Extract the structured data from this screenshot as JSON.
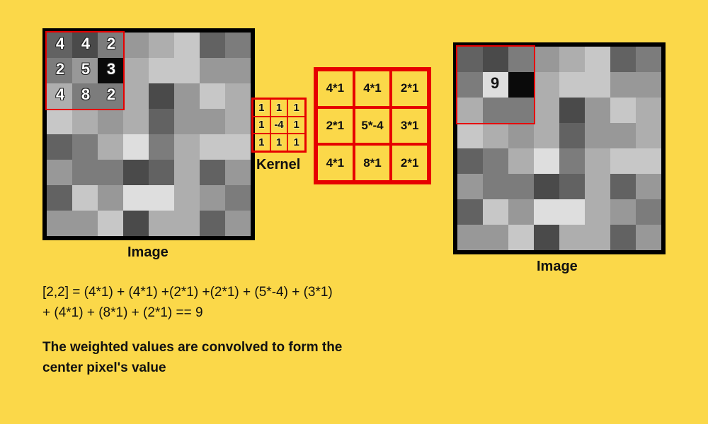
{
  "colors": {
    "shades": [
      "#dedede",
      "#c7c7c7",
      "#aeaeae",
      "#989898",
      "#7c7c7c",
      "#626262",
      "#4a4a4a",
      "#2d2d2d",
      "#0a0a0a"
    ]
  },
  "leftImage": {
    "grid": [
      [
        5,
        6,
        4,
        3,
        2,
        1,
        5,
        4
      ],
      [
        4,
        3,
        8,
        2,
        1,
        1,
        3,
        3
      ],
      [
        2,
        4,
        4,
        2,
        6,
        3,
        1,
        2
      ],
      [
        1,
        2,
        3,
        2,
        5,
        3,
        3,
        2
      ],
      [
        5,
        4,
        2,
        0,
        4,
        2,
        1,
        1
      ],
      [
        3,
        4,
        4,
        6,
        5,
        2,
        5,
        3
      ],
      [
        5,
        1,
        3,
        0,
        0,
        2,
        3,
        4
      ],
      [
        3,
        3,
        1,
        6,
        2,
        2,
        5,
        3
      ]
    ],
    "overlay": [
      [
        "4",
        "4",
        "2"
      ],
      [
        "2",
        "5",
        "3"
      ],
      [
        "4",
        "8",
        "2"
      ]
    ],
    "label": "Image"
  },
  "rightImage": {
    "grid": [
      [
        5,
        6,
        4,
        3,
        2,
        1,
        5,
        4
      ],
      [
        4,
        0,
        8,
        2,
        1,
        1,
        3,
        3
      ],
      [
        2,
        4,
        4,
        2,
        6,
        3,
        1,
        2
      ],
      [
        1,
        2,
        3,
        2,
        5,
        3,
        3,
        2
      ],
      [
        5,
        4,
        2,
        0,
        4,
        2,
        1,
        1
      ],
      [
        3,
        4,
        4,
        6,
        5,
        2,
        5,
        3
      ],
      [
        5,
        1,
        3,
        0,
        0,
        2,
        3,
        4
      ],
      [
        3,
        3,
        1,
        6,
        2,
        2,
        5,
        3
      ]
    ],
    "result": "9",
    "label": "Image"
  },
  "kernel": {
    "values": [
      "1",
      "1",
      "1",
      "1",
      "-4",
      "1",
      "1",
      "1",
      "1"
    ],
    "label": "Kernel"
  },
  "multiplication": {
    "values": [
      "4*1",
      "4*1",
      "2*1",
      "2*1",
      "5*-4",
      "3*1",
      "4*1",
      "8*1",
      "2*1"
    ]
  },
  "equation": {
    "line1": "[2,2] = (4*1) + (4*1) +(2*1) +(2*1) + (5*-4) + (3*1)",
    "line2": "+ (4*1) + (8*1) + (2*1) == 9"
  },
  "description": {
    "line1": "The weighted values are convolved to form the",
    "line2": "center pixel's value"
  }
}
